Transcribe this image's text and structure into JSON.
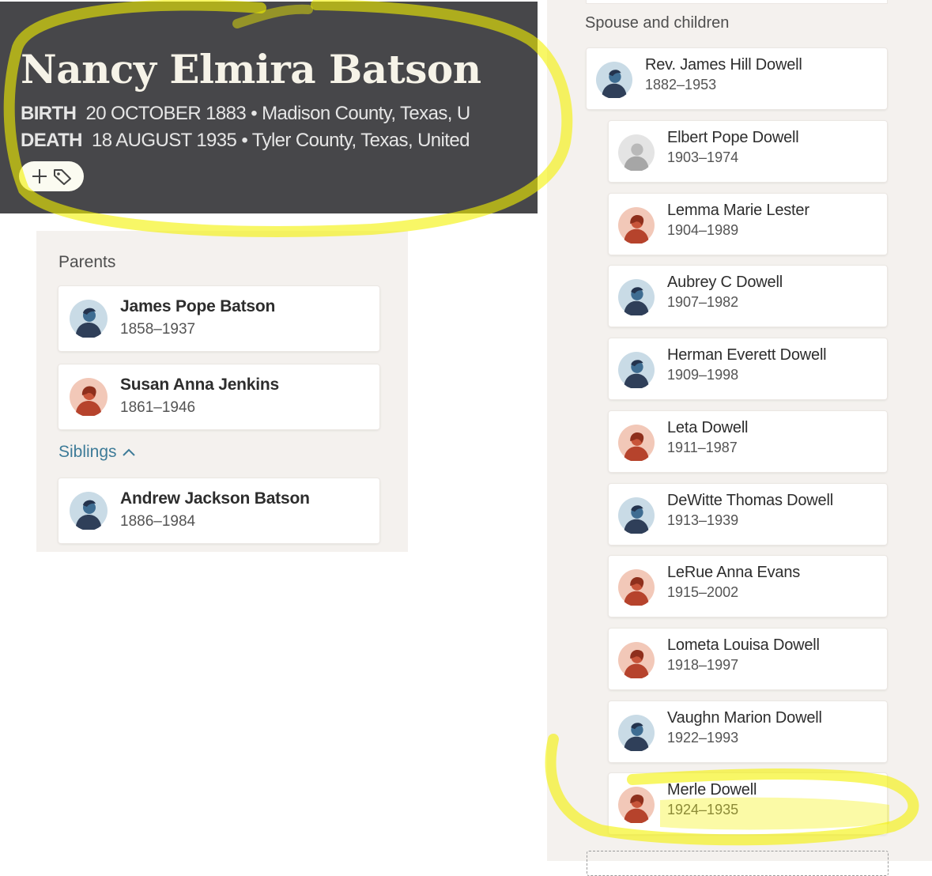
{
  "person": {
    "name": "Nancy Elmira Batson",
    "birth_label": "BIRTH",
    "birth_value": "20 OCTOBER 1883 • Madison County, Texas, U",
    "death_label": "DEATH",
    "death_value": "18 AUGUST 1935 • Tyler County, Texas, United",
    "tag_button_icons": [
      "plus-icon",
      "tag-icon"
    ]
  },
  "parents_section": {
    "label": "Parents",
    "parents": [
      {
        "name": "James Pope Batson",
        "years": "1858–1937",
        "gender": "male"
      },
      {
        "name": "Susan Anna Jenkins",
        "years": "1861–1946",
        "gender": "female"
      }
    ]
  },
  "siblings_section": {
    "label": "Siblings",
    "toggle_icon": "chevron-up-icon",
    "siblings": [
      {
        "name": "Andrew Jackson Batson",
        "years": "1886–1984",
        "gender": "male"
      }
    ]
  },
  "spouse_section": {
    "label": "Spouse and children",
    "spouse": {
      "name": "Rev. James Hill Dowell",
      "years": "1882–1953",
      "gender": "male"
    },
    "children": [
      {
        "name": "Elbert Pope Dowell",
        "years": "1903–1974",
        "gender": "unknown"
      },
      {
        "name": "Lemma Marie Lester",
        "years": "1904–1989",
        "gender": "female"
      },
      {
        "name": "Aubrey C Dowell",
        "years": "1907–1982",
        "gender": "male"
      },
      {
        "name": "Herman Everett Dowell",
        "years": "1909–1998",
        "gender": "male"
      },
      {
        "name": "Leta Dowell",
        "years": "1911–1987",
        "gender": "female"
      },
      {
        "name": "DeWitte Thomas Dowell",
        "years": "1913–1939",
        "gender": "male"
      },
      {
        "name": "LeRue Anna Evans",
        "years": "1915–2002",
        "gender": "female"
      },
      {
        "name": "Lometa Louisa Dowell",
        "years": "1918–1997",
        "gender": "female"
      },
      {
        "name": "Vaughn Marion Dowell",
        "years": "1922–1993",
        "gender": "male"
      },
      {
        "name": "Merle Dowell",
        "years": "1924–1935",
        "gender": "female"
      }
    ]
  },
  "colors": {
    "header_bg": "#47474a",
    "panel_bg": "#f4f1ee",
    "link": "#3d7b98",
    "highlight": "#f4f200"
  }
}
